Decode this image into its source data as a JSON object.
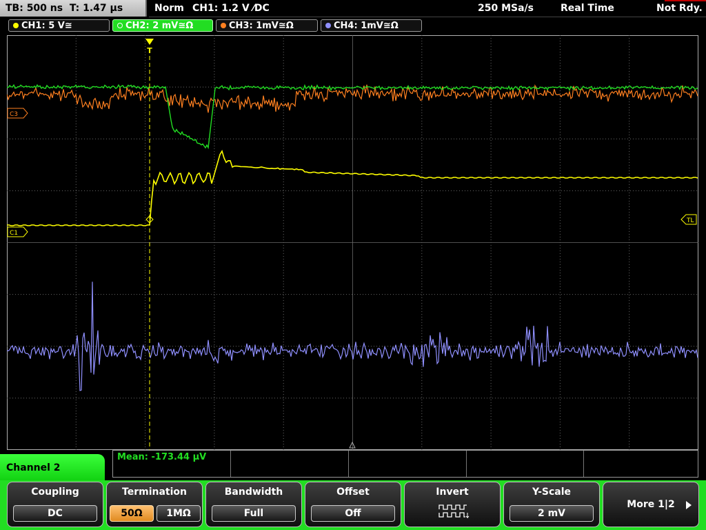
{
  "topbar": {
    "timebase": "TB: 500 ns",
    "trigger_time": "T: 1.47 µs",
    "trigger_mode": "Norm",
    "trigger_info": "CH1: 1.2 V ⁄DC",
    "sample_rate": "250 MSa/s",
    "acquisition_mode": "Real Time",
    "trigger_state": "Not Rdy."
  },
  "channel_tabs": [
    {
      "label": "CH1: 5 V≅",
      "color": "#ffff00"
    },
    {
      "label": "CH2: 2 mV≅Ω",
      "color": "#22dd22"
    },
    {
      "label": "CH3: 1mV≅Ω",
      "color": "#ff8020"
    },
    {
      "label": "CH4: 1mV≅Ω",
      "color": "#9090ff"
    }
  ],
  "markers": {
    "ch1_ref": "C1",
    "ch3_ref": "C3",
    "trigger_level": "TL",
    "trigger_pos": "T"
  },
  "measurement": {
    "text": "Mean: -173.44 µV"
  },
  "menu": {
    "title": "Channel 2",
    "coupling_label": "Coupling",
    "coupling_value": "DC",
    "termination_label": "Termination",
    "termination_opt1": "50Ω",
    "termination_opt2": "1MΩ",
    "bandwidth_label": "Bandwidth",
    "bandwidth_value": "Full",
    "offset_label": "Offset",
    "offset_value": "Off",
    "invert_label": "Invert",
    "yscale_label": "Y-Scale",
    "yscale_value": "2 mV",
    "more_label": "More 1|2"
  },
  "colors": {
    "ch1": "#ffff00",
    "ch2": "#22dd22",
    "ch3": "#ff8020",
    "ch4": "#9090ff",
    "grid": "#6a6a6a"
  }
}
